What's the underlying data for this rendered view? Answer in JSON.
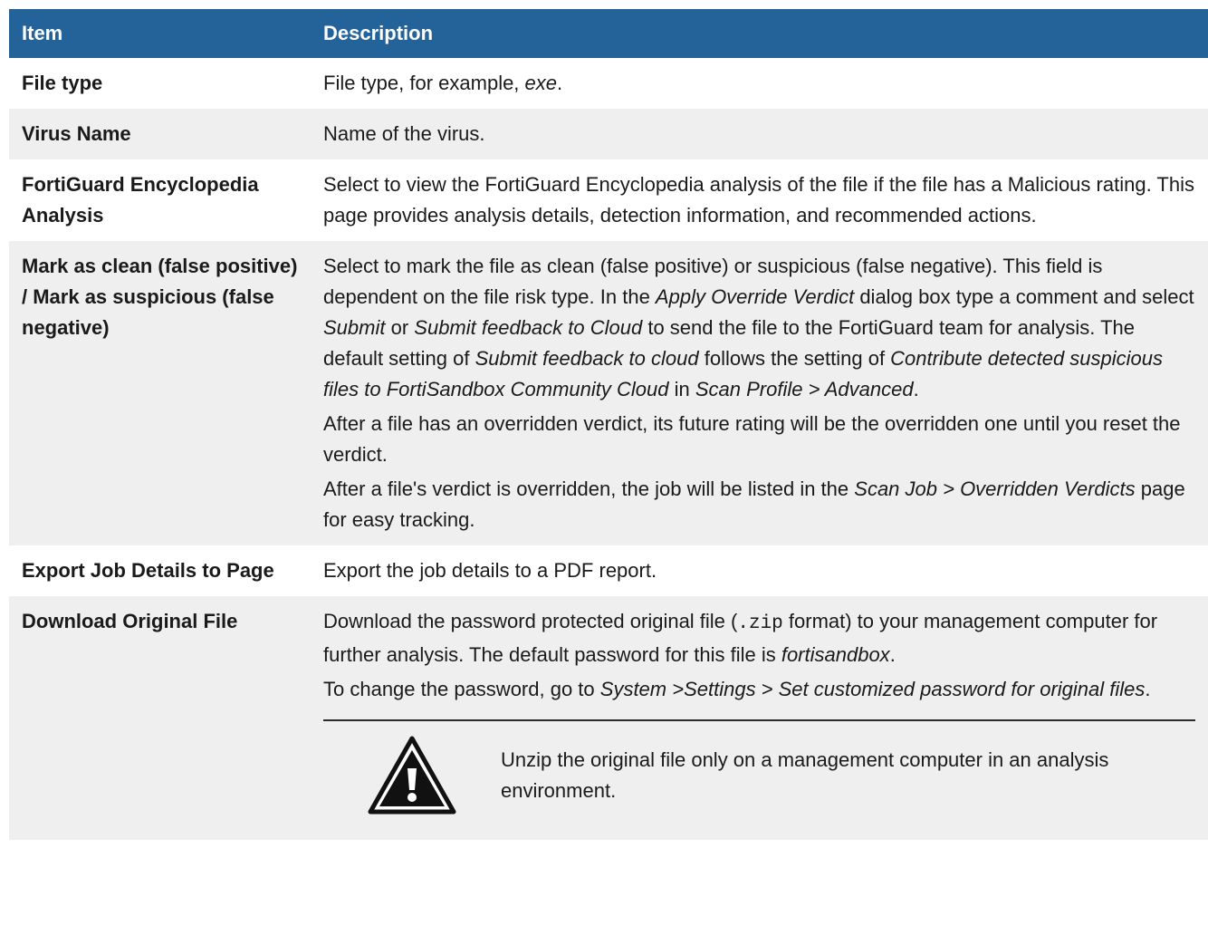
{
  "header": {
    "item": "Item",
    "description": "Description"
  },
  "rows": {
    "file_type": {
      "item": "File type",
      "desc_before": "File type, for example, ",
      "desc_em": "exe",
      "desc_after": "."
    },
    "virus_name": {
      "item": "Virus Name",
      "desc": "Name of the virus."
    },
    "fortiguard": {
      "item": "FortiGuard Encyclopedia Analysis",
      "desc": "Select to view the FortiGuard Encyclopedia analysis of the file if the file has a Malicious rating. This page provides analysis details, detection information, and recommended actions."
    },
    "mark_clean": {
      "item": "Mark as clean (false positive) / Mark as suspicious (false negative)",
      "p1_a": "Select to mark the file as clean (false positive) or suspicious (false negative). This field is dependent on the file risk type. In the ",
      "p1_em1": "Apply Override Verdict",
      "p1_b": " dialog box type a comment and select ",
      "p1_em2": "Submit",
      "p1_c": " or ",
      "p1_em3": "Submit feedback to Cloud",
      "p1_d": " to send the file to the FortiGuard team for analysis. The default setting of ",
      "p1_em4": "Submit feedback to cloud",
      "p1_e": " follows the setting of ",
      "p1_em5": "Contribute detected suspicious files to FortiSandbox Community Cloud",
      "p1_f": " in ",
      "p1_em6": "Scan Profile > Advanced",
      "p1_g": ".",
      "p2": "After a file has an overridden verdict, its future rating will be the overridden one until you reset the verdict.",
      "p3_a": "After a file's verdict is overridden, the job will be listed in the ",
      "p3_em": "Scan Job > Overridden Verdicts",
      "p3_b": " page for easy tracking."
    },
    "export": {
      "item": "Export Job Details to Page",
      "desc": "Export the job details to a PDF report."
    },
    "download": {
      "item": "Download Original File",
      "p1_a": "Download the password protected original file (",
      "p1_code": ".zip",
      "p1_b": " format) to your management computer for further analysis. The default password for this file is ",
      "p1_em": "fortisandbox",
      "p1_c": ".",
      "p2_a": "To change the password, go to ",
      "p2_em": "System >Settings > Set customized password for original files",
      "p2_b": ".",
      "warning": "Unzip the original file only on a management computer in an analysis environment."
    }
  },
  "colors": {
    "header_bg": "#23639a",
    "alt_row_bg": "#efefef"
  },
  "icons": {
    "warning": "warning-triangle-icon"
  }
}
